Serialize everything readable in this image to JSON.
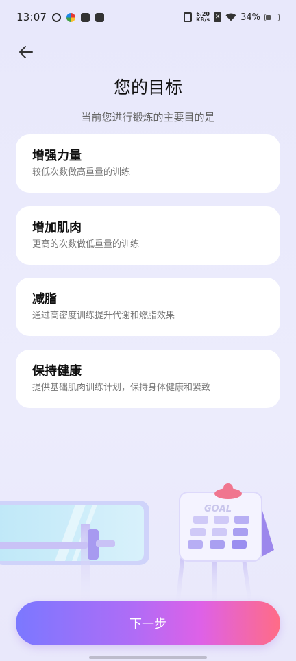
{
  "status_bar": {
    "time": "13:07",
    "net_speed_top": "6.20",
    "net_speed_bottom": "KB/s",
    "battery": "34%"
  },
  "header": {
    "title": "您的目标",
    "subtitle": "当前您进行锻炼的主要目的是"
  },
  "goals": [
    {
      "title": "增强力量",
      "desc": "较低次数做高重量的训练"
    },
    {
      "title": "增加肌肉",
      "desc": "更高的次数做低重量的训练"
    },
    {
      "title": "减脂",
      "desc": "通过高密度训练提升代谢和燃脂效果"
    },
    {
      "title": "保持健康",
      "desc": "提供基础肌肉训练计划，保持身体健康和紧致"
    }
  ],
  "illustration": {
    "board_label": "GOAL"
  },
  "footer": {
    "next_label": "下一步"
  },
  "colors": {
    "accent_start": "#7b78ff",
    "accent_end": "#ff6c86",
    "background": "#e8e8fb"
  }
}
